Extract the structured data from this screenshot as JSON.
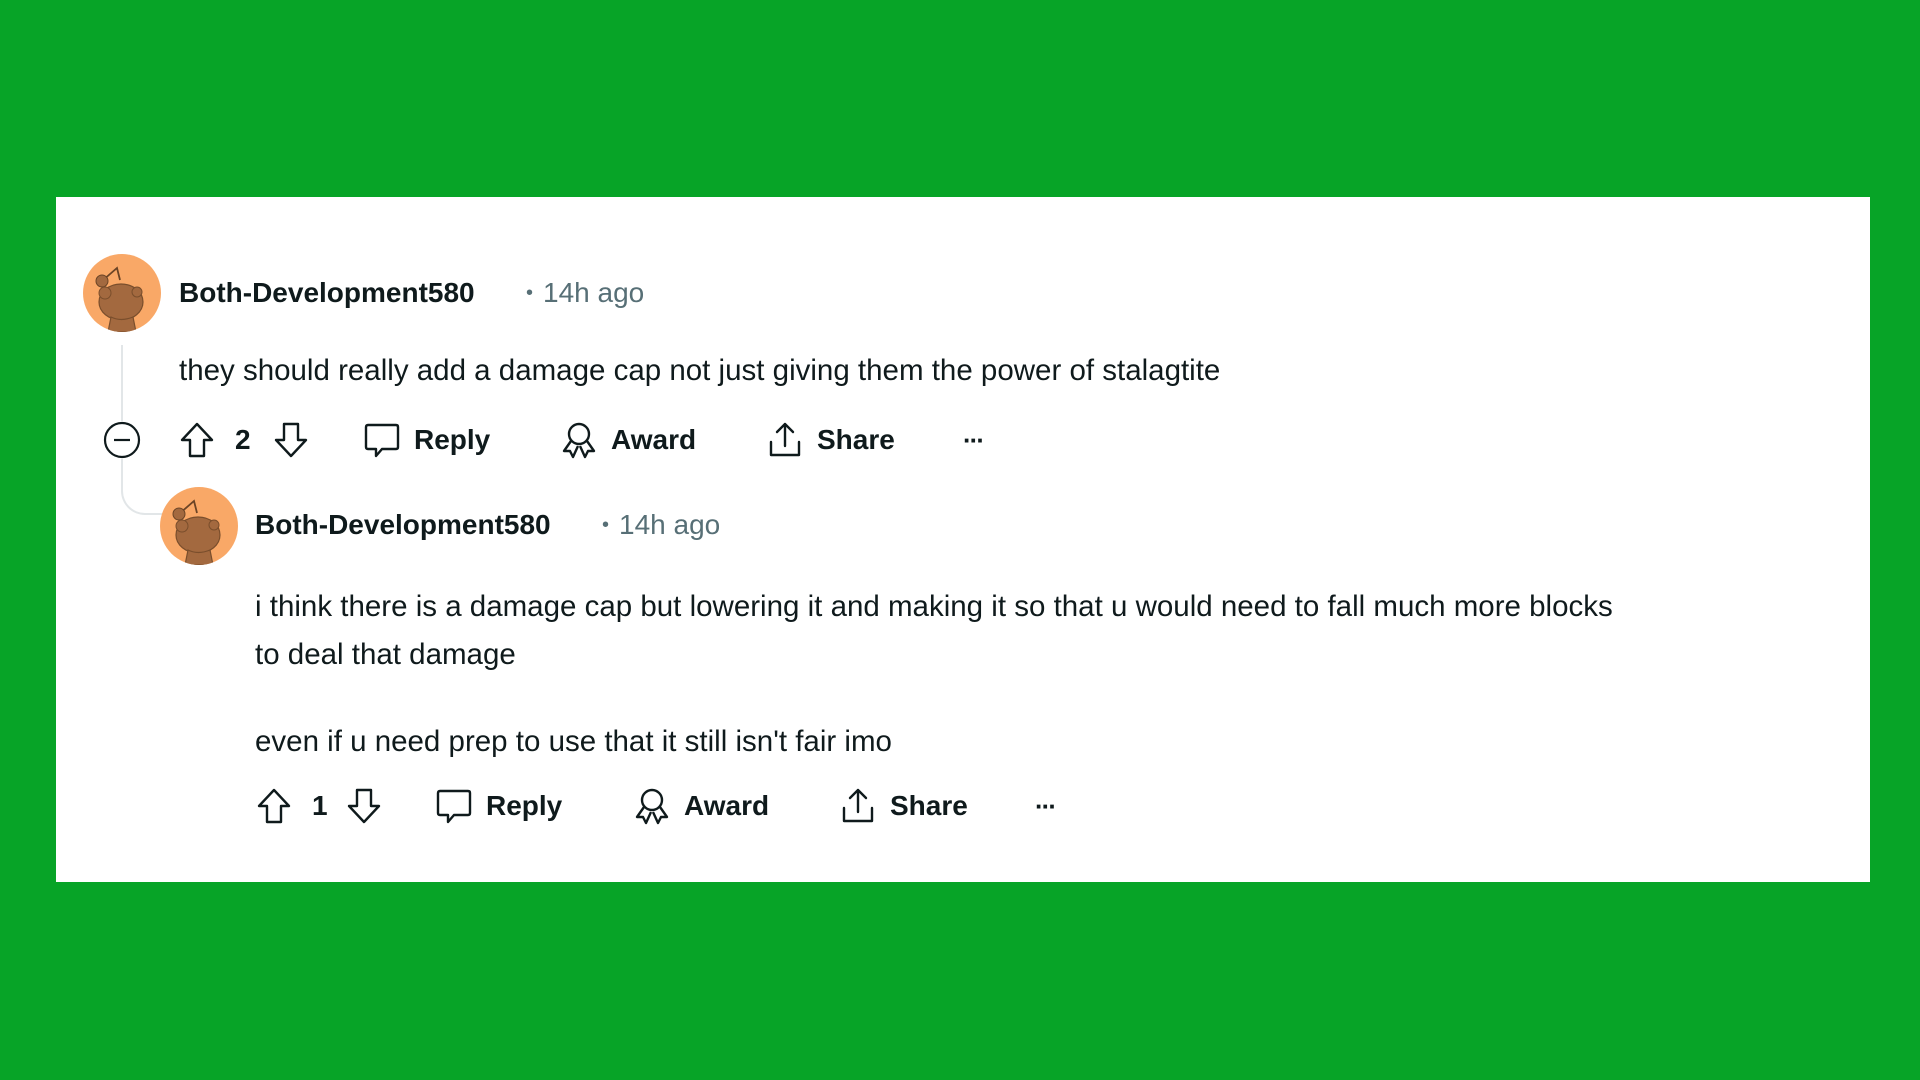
{
  "colors": {
    "background": "#07a427",
    "card": "#ffffff",
    "text": "#0f1a1c",
    "meta": "#576f76",
    "avatar_bg": "#f9a867",
    "avatar_figure": "#a3693f"
  },
  "comments": [
    {
      "author": "Both-Development580",
      "separator": "•",
      "timestamp": "14h ago",
      "avatar_icon": "snoo-avatar-icon",
      "body": [
        "they should really add a damage cap not just giving them the power of stalagtite"
      ],
      "score": "2",
      "actions": {
        "collapse_icon": "collapse-minus-icon",
        "upvote_icon": "upvote-arrow-icon",
        "downvote_icon": "downvote-arrow-icon",
        "reply": "Reply",
        "award": "Award",
        "share": "Share",
        "more": "···"
      }
    },
    {
      "author": "Both-Development580",
      "separator": "•",
      "timestamp": "14h ago",
      "avatar_icon": "snoo-avatar-icon",
      "body": [
        "i think there is a damage cap but lowering it and making it so that u would need to fall much more blocks",
        "to deal that damage",
        "even if u need prep to use that it still isn't fair imo"
      ],
      "score": "1",
      "actions": {
        "upvote_icon": "upvote-arrow-icon",
        "downvote_icon": "downvote-arrow-icon",
        "reply": "Reply",
        "award": "Award",
        "share": "Share",
        "more": "···"
      }
    }
  ]
}
